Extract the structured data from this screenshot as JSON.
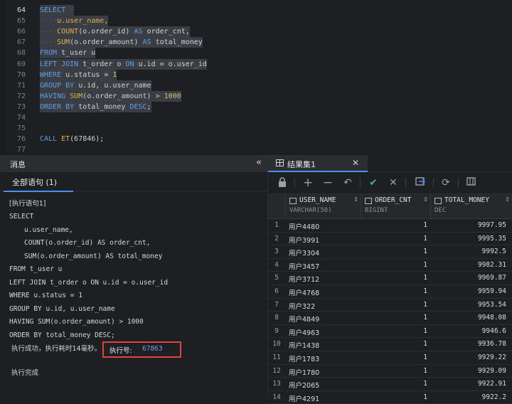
{
  "editor": {
    "lines": [
      {
        "num": "64",
        "tokens": [
          {
            "t": "SELECT",
            "c": "kw"
          },
          {
            "t": " ·",
            "c": "dot"
          }
        ],
        "sel": true,
        "cur": true
      },
      {
        "num": "65",
        "tokens": [
          {
            "t": "····",
            "c": "dot"
          },
          {
            "t": "u.user_name,",
            "c": "fn"
          }
        ],
        "sel": true
      },
      {
        "num": "66",
        "tokens": [
          {
            "t": "····",
            "c": "dot"
          },
          {
            "t": "COUNT",
            "c": "fn"
          },
          {
            "t": "(o.order_id)",
            "c": "id"
          },
          {
            "t": " AS ",
            "c": "kw"
          },
          {
            "t": "order_cnt,",
            "c": "id"
          }
        ],
        "sel": true
      },
      {
        "num": "67",
        "tokens": [
          {
            "t": "····",
            "c": "dot"
          },
          {
            "t": "SUM",
            "c": "fn"
          },
          {
            "t": "(o.order_amount)",
            "c": "id"
          },
          {
            "t": " AS ",
            "c": "kw"
          },
          {
            "t": "total_money",
            "c": "id"
          }
        ],
        "sel": true
      },
      {
        "num": "68",
        "tokens": [
          {
            "t": "FROM",
            "c": "kw"
          },
          {
            "t": " t_user u",
            "c": "id"
          }
        ],
        "sel": true
      },
      {
        "num": "69",
        "tokens": [
          {
            "t": "LEFT JOIN",
            "c": "kw"
          },
          {
            "t": " t_order o ",
            "c": "id"
          },
          {
            "t": "ON",
            "c": "kw"
          },
          {
            "t": " u.id = o.user_id",
            "c": "id"
          }
        ],
        "sel": true
      },
      {
        "num": "70",
        "tokens": [
          {
            "t": "WHERE",
            "c": "kw"
          },
          {
            "t": " u.status = ",
            "c": "id"
          },
          {
            "t": "1",
            "c": "num"
          }
        ],
        "sel": true
      },
      {
        "num": "71",
        "tokens": [
          {
            "t": "GROUP BY",
            "c": "kw"
          },
          {
            "t": " u.id, u.user_name",
            "c": "id"
          }
        ],
        "sel": true
      },
      {
        "num": "72",
        "tokens": [
          {
            "t": "HAVING",
            "c": "kw"
          },
          {
            "t": " ",
            "c": "id"
          },
          {
            "t": "SUM",
            "c": "fn"
          },
          {
            "t": "(o.order_amount) > ",
            "c": "id"
          },
          {
            "t": "1000",
            "c": "num"
          }
        ],
        "sel": true
      },
      {
        "num": "73",
        "tokens": [
          {
            "t": "ORDER BY",
            "c": "kw"
          },
          {
            "t": " total_money ",
            "c": "id"
          },
          {
            "t": "DESC",
            "c": "kw"
          },
          {
            "t": ";",
            "c": "id"
          }
        ],
        "sel": true
      },
      {
        "num": "74",
        "tokens": [],
        "sel": false
      },
      {
        "num": "75",
        "tokens": [],
        "sel": false
      },
      {
        "num": "76",
        "tokens": [
          {
            "t": "CALL ",
            "c": "kw"
          },
          {
            "t": "ET",
            "c": "fn"
          },
          {
            "t": "(67846);",
            "c": "id"
          }
        ],
        "sel": false
      },
      {
        "num": "77",
        "tokens": [],
        "sel": false
      }
    ]
  },
  "messages": {
    "title": "消息",
    "tab_all": "全部语句 (1)",
    "lines": [
      "[执行语句1]",
      "SELECT",
      "u.user_name,",
      "COUNT(o.order_id) AS order_cnt,",
      "SUM(o.order_amount) AS total_money",
      "FROM t_user u",
      "LEFT JOIN t_order o ON u.id = o.user_id",
      "WHERE u.status = 1",
      "GROUP BY u.id, u.user_name",
      "HAVING SUM(o.order_amount) > 1000",
      "ORDER BY total_money DESC;"
    ],
    "success_text": "执行成功，执行耗时14毫秒。",
    "exec_id_label": "执行号:",
    "exec_id_value": "67863",
    "done_text": "执行完成"
  },
  "result": {
    "tab_label": "结果集1",
    "columns": [
      {
        "name": "USER_NAME",
        "type": "VARCHAR(50)"
      },
      {
        "name": "ORDER_CNT",
        "type": "BIGINT"
      },
      {
        "name": "TOTAL_MONEY",
        "type": "DEC"
      }
    ],
    "rows": [
      [
        "1",
        "用户4480",
        "1",
        "9997.95"
      ],
      [
        "2",
        "用户3991",
        "1",
        "9995.35"
      ],
      [
        "3",
        "用户3304",
        "1",
        "9992.5"
      ],
      [
        "4",
        "用户3457",
        "1",
        "9982.31"
      ],
      [
        "5",
        "用户3712",
        "1",
        "9969.87"
      ],
      [
        "6",
        "用户4768",
        "1",
        "9959.94"
      ],
      [
        "7",
        "用户322",
        "1",
        "9953.54"
      ],
      [
        "8",
        "用户4849",
        "1",
        "9948.08"
      ],
      [
        "9",
        "用户4963",
        "1",
        "9946.6"
      ],
      [
        "10",
        "用户1438",
        "1",
        "9936.78"
      ],
      [
        "11",
        "用户1783",
        "1",
        "9929.22"
      ],
      [
        "12",
        "用户1780",
        "1",
        "9929.09"
      ],
      [
        "13",
        "用户2065",
        "1",
        "9922.91"
      ],
      [
        "14",
        "用户4291",
        "1",
        "9922.2"
      ]
    ],
    "toolbar": [
      "lock-icon",
      "add-icon",
      "remove-icon",
      "undo-icon",
      "commit-icon",
      "rollback-icon",
      "export-icon",
      "refresh-icon",
      "columns-icon"
    ]
  }
}
